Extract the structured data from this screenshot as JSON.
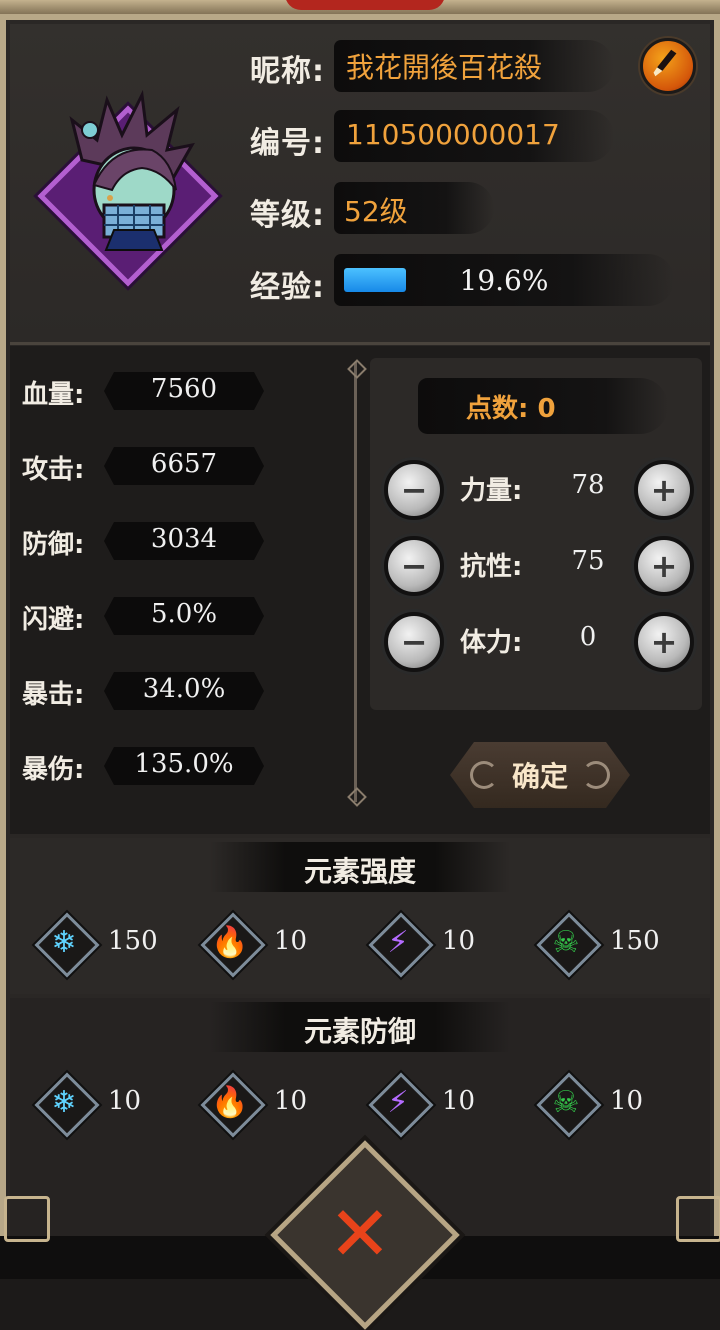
{
  "profile": {
    "nickname_label": "昵称:",
    "nickname": "我花開後百花殺",
    "id_label": "编号:",
    "id": "110500000017",
    "level_label": "等级:",
    "level": "52级",
    "exp_label": "经验:",
    "exp_text": "19.6%",
    "exp_fraction": 0.196,
    "edit_icon": "brush-icon"
  },
  "stats": [
    {
      "label": "血量:",
      "value": "7560"
    },
    {
      "label": "攻击:",
      "value": "6657"
    },
    {
      "label": "防御:",
      "value": "3034"
    },
    {
      "label": "闪避:",
      "value": "5.0%"
    },
    {
      "label": "暴击:",
      "value": "34.0%"
    },
    {
      "label": "暴伤:",
      "value": "135.0%"
    }
  ],
  "points": {
    "label": "点数: 0",
    "attributes": [
      {
        "label": "力量:",
        "value": "78"
      },
      {
        "label": "抗性:",
        "value": "75"
      },
      {
        "label": "体力:",
        "value": "0"
      }
    ],
    "minus_glyph": "−",
    "plus_glyph": "+",
    "confirm_label": "确定"
  },
  "element_strength": {
    "title": "元素强度",
    "items": [
      {
        "icon": "ice-icon",
        "glyph": "❄",
        "color": "#5fd3ff",
        "value": "150"
      },
      {
        "icon": "fire-icon",
        "glyph": "🔥",
        "color": "#ff8a1d",
        "value": "10"
      },
      {
        "icon": "lightning-icon",
        "glyph": "⚡",
        "color": "#b56cff",
        "value": "10"
      },
      {
        "icon": "poison-skull-icon",
        "glyph": "☠",
        "color": "#34c84a",
        "value": "150"
      }
    ]
  },
  "element_defense": {
    "title": "元素防御",
    "items": [
      {
        "icon": "ice-icon",
        "glyph": "❄",
        "color": "#5fd3ff",
        "value": "10"
      },
      {
        "icon": "fire-icon",
        "glyph": "🔥",
        "color": "#ff8a1d",
        "value": "10"
      },
      {
        "icon": "lightning-icon",
        "glyph": "⚡",
        "color": "#b56cff",
        "value": "10"
      },
      {
        "icon": "poison-skull-icon",
        "glyph": "☠",
        "color": "#34c84a",
        "value": "10"
      }
    ]
  },
  "close": {
    "glyph": "✕",
    "icon": "close-icon"
  },
  "colors": {
    "accent_orange": "#f0a23c",
    "exp_blue": "#1789e8",
    "close_red": "#e8431a"
  }
}
